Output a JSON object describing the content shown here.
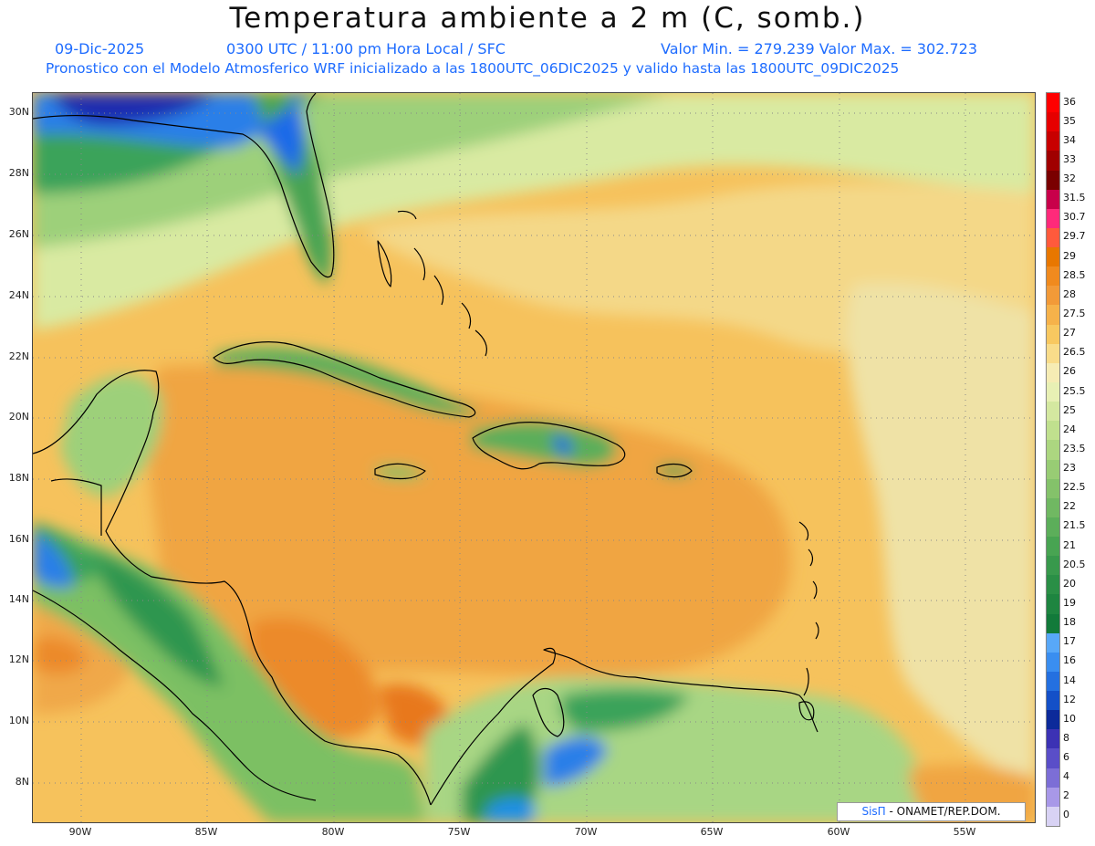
{
  "title": "Temperatura ambiente a 2 m (C, somb.)",
  "info": {
    "date": "09-Dic-2025",
    "time": "0300 UTC / 11:00 pm Hora Local / SFC",
    "min_max": "Valor Min. = 279.239  Valor Max. = 302.723",
    "model": "Pronostico con el Modelo Atmosferico WRF inicializado a las 1800UTC_06DIC2025 y valido hasta las  1800UTC_09DIC2025"
  },
  "lat_labels": [
    "30N",
    "28N",
    "26N",
    "24N",
    "22N",
    "20N",
    "18N",
    "16N",
    "14N",
    "12N",
    "10N",
    "8N"
  ],
  "lon_labels": [
    "90W",
    "85W",
    "80W",
    "75W",
    "70W",
    "65W",
    "60W",
    "55W"
  ],
  "colorbar": {
    "levels": [
      "36",
      "35",
      "34",
      "33",
      "32",
      "31.5",
      "30.7",
      "29.7",
      "29",
      "28.5",
      "28",
      "27.5",
      "27",
      "26.5",
      "26",
      "25.5",
      "25",
      "24",
      "23.5",
      "23",
      "22.5",
      "22",
      "21.5",
      "21",
      "20.5",
      "20",
      "19",
      "18",
      "17",
      "16",
      "14",
      "12",
      "10",
      "8",
      "6",
      "4",
      "2",
      "0"
    ],
    "colors": [
      "#ff0000",
      "#e60000",
      "#c80000",
      "#a00000",
      "#7a0000",
      "#c8004a",
      "#ff2a7a",
      "#ff5a3c",
      "#e87700",
      "#f08a1e",
      "#f29a38",
      "#f6b24a",
      "#f8c860",
      "#f9dc8a",
      "#f6ecb4",
      "#e8f0b4",
      "#d4e8a0",
      "#c0e08e",
      "#acd680",
      "#98cc74",
      "#84c26a",
      "#70b862",
      "#5cae5a",
      "#48a452",
      "#38994c",
      "#2a8f46",
      "#1e8540",
      "#127a3a",
      "#58a8f8",
      "#3a8ef0",
      "#2470e0",
      "#1450c8",
      "#0c2a9a",
      "#3c32b4",
      "#5a4ec8",
      "#7c6ed6",
      "#a898e8",
      "#d8d2f4"
    ]
  },
  "credit": {
    "brand": "SisΠ",
    "text": " - ONAMET/REP.DOM."
  }
}
